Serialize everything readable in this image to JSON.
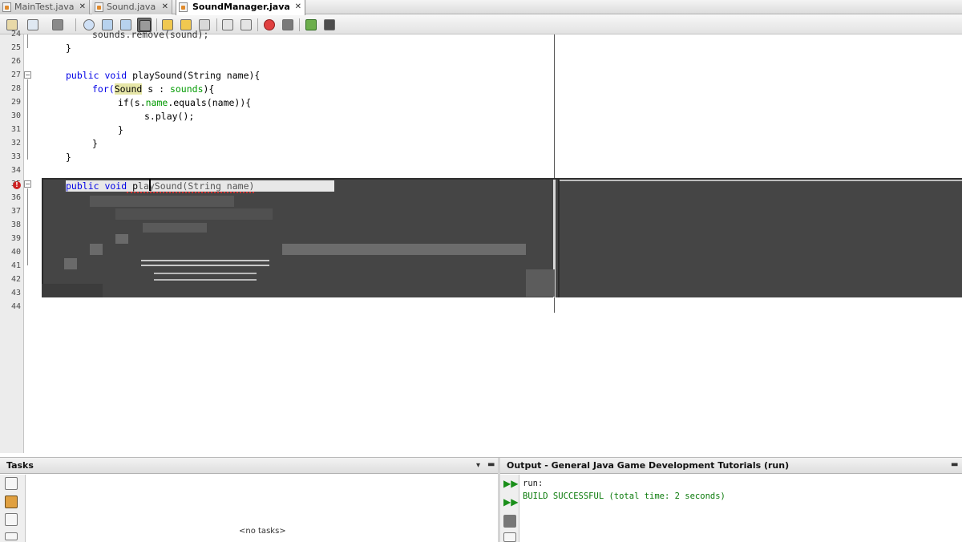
{
  "tabs": [
    {
      "label": "MainTest.java",
      "active": false
    },
    {
      "label": "Sound.java",
      "active": false
    },
    {
      "label": "SoundManager.java",
      "active": true
    }
  ],
  "tab_close_glyph": "✕",
  "editor": {
    "line_numbers": [
      "24",
      "25",
      "26",
      "27",
      "28",
      "29",
      "30",
      "31",
      "32",
      "33",
      "34",
      "35",
      "36",
      "37",
      "38",
      "39",
      "40",
      "41",
      "42",
      "43",
      "44"
    ],
    "code": {
      "l24": "sounds.remove(sound);",
      "l25": "}",
      "l27_kw": "public void",
      "l27_rest": " playSound(String name){",
      "l28_for": "for(",
      "l28_type": "Sound",
      "l28_mid": " s : ",
      "l28_fld": "sounds",
      "l28_end": "){",
      "l29_if": "if(s.",
      "l29_fld": "name",
      "l29_end": ".equals(name)){",
      "l30": "s.play();",
      "l31": "}",
      "l32": "}",
      "l33": "}",
      "l35_kw": "public void",
      "l35_a": " p",
      "l35_b": "laySound(String name)"
    },
    "error_glyph": "!"
  },
  "tasks_panel": {
    "title": "Tasks",
    "empty_text": "<no tasks>"
  },
  "output_panel": {
    "title": "Output - General Java Game Development Tutorials (run)",
    "lines": [
      "run:",
      "BUILD SUCCESSFUL (total time: 2 seconds)"
    ]
  },
  "colors": {
    "keyword": "#0000e6",
    "field": "#009a00",
    "build_success": "#0a7a0a"
  }
}
